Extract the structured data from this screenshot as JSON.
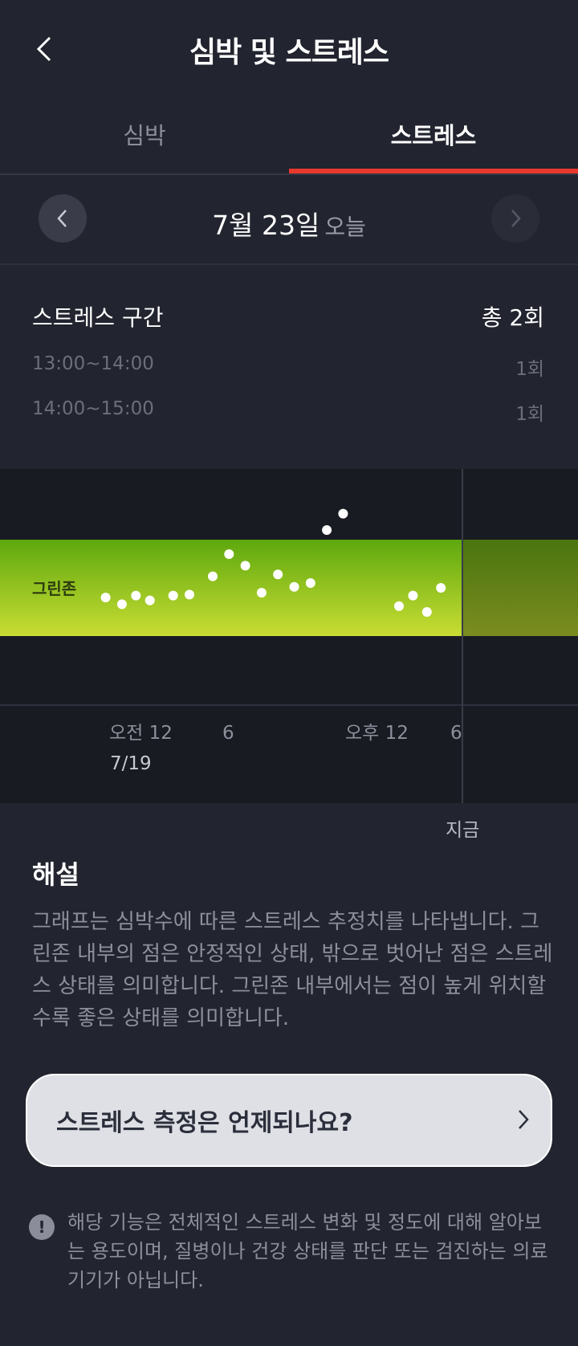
{
  "header": {
    "title": "심박 및 스트레스",
    "back_icon": "chevron-left-icon"
  },
  "tabs": [
    {
      "label": "심박",
      "active": false
    },
    {
      "label": "스트레스",
      "active": true
    }
  ],
  "accent_color": "#e8392d",
  "date_nav": {
    "date": "7월 23일",
    "sub": "오늘",
    "prev_icon": "chevron-left-icon",
    "next_icon": "chevron-right-icon"
  },
  "stress_summary": {
    "title": "스트레스 구간",
    "total": "총 2회",
    "rows": [
      {
        "time": "13:00~14:00",
        "count": "1회"
      },
      {
        "time": "14:00~15:00",
        "count": "1회"
      }
    ]
  },
  "chart_data": {
    "type": "scatter",
    "zone_label": "그린존",
    "x_ticks": [
      "오전 12",
      "6",
      "오후 12",
      "6"
    ],
    "x_date_label": "7/19",
    "now_label": "지금",
    "points": [
      {
        "x": 0.4,
        "y": 0.4
      },
      {
        "x": 1.1,
        "y": 0.33
      },
      {
        "x": 1.7,
        "y": 0.42
      },
      {
        "x": 2.3,
        "y": 0.37
      },
      {
        "x": 3.3,
        "y": 0.42
      },
      {
        "x": 4.0,
        "y": 0.43
      },
      {
        "x": 5.0,
        "y": 0.62
      },
      {
        "x": 5.7,
        "y": 0.85
      },
      {
        "x": 6.4,
        "y": 0.73
      },
      {
        "x": 7.1,
        "y": 0.45
      },
      {
        "x": 7.8,
        "y": 0.64
      },
      {
        "x": 8.5,
        "y": 0.51
      },
      {
        "x": 9.2,
        "y": 0.55
      },
      {
        "x": 9.9,
        "y": 1.1
      },
      {
        "x": 10.6,
        "y": 1.27
      },
      {
        "x": 13.0,
        "y": 0.31
      },
      {
        "x": 13.6,
        "y": 0.42
      },
      {
        "x": 14.2,
        "y": 0.25
      },
      {
        "x": 14.8,
        "y": 0.5
      }
    ],
    "zone_range": [
      0,
      1
    ],
    "y_range": [
      -0.75,
      1.7
    ]
  },
  "commentary": {
    "title": "해설",
    "body": "그래프는 심박수에 따른 스트레스 추정치를 나타냅니다. 그린존 내부의 점은 안정적인 상태, 밖으로 벗어난 점은 스트레스 상태를 의미합니다. 그린존 내부에서는 점이 높게 위치할수록 좋은 상태를 의미합니다."
  },
  "faq_button": {
    "label": "스트레스 측정은 언제되나요?",
    "icon": "chevron-right-icon"
  },
  "disclaimer": {
    "icon": "exclamation-icon",
    "text": "해당 기능은 전체적인 스트레스 변화 및 정도에 대해 알아보는 용도이며, 질병이나 건강 상태를 판단 또는 검진하는 의료기기가 아닙니다."
  }
}
